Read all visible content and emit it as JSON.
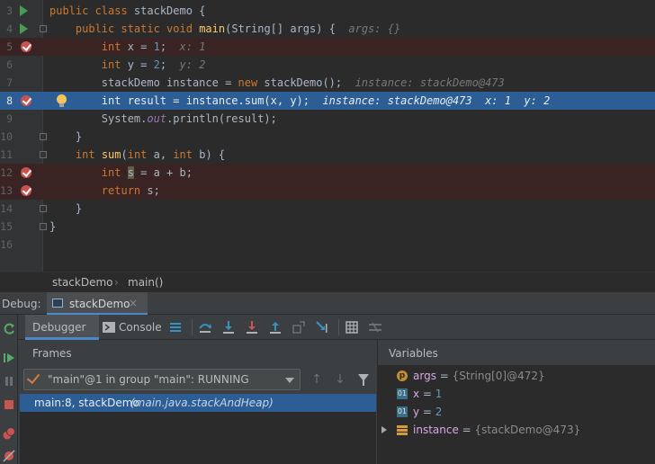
{
  "editor": {
    "lines": [
      {
        "num": "3"
      },
      {
        "num": "4"
      },
      {
        "num": "5"
      },
      {
        "num": "6"
      },
      {
        "num": "7"
      },
      {
        "num": "8"
      },
      {
        "num": "9"
      },
      {
        "num": "10"
      },
      {
        "num": "11"
      },
      {
        "num": "12"
      },
      {
        "num": "13"
      },
      {
        "num": "14"
      },
      {
        "num": "15"
      },
      {
        "num": "16"
      }
    ],
    "tokens": {
      "l3_kw": "public class ",
      "l3_txt": "stackDemo {",
      "l4_kw": "public static void ",
      "l4_fn": "main",
      "l4_txt": "(String[] args) {",
      "l4_hint": "args: {}",
      "l5_kw": "int ",
      "l5_txt1": "x = ",
      "l5_num": "1",
      "l5_txt2": ";",
      "l5_hint": "x: 1",
      "l6_kw": "int ",
      "l6_txt1": "y = ",
      "l6_num": "2",
      "l6_txt2": ";",
      "l6_hint": "y: 2",
      "l7_txt1": "stackDemo instance = ",
      "l7_kw": "new ",
      "l7_txt2": "stackDemo();",
      "l7_hint": "instance: stackDemo@473",
      "l8_kw": "int ",
      "l8_txt": "result = instance.sum(x, y);",
      "l8_hint": "instance: stackDemo@473  x: 1  y: 2",
      "l9_txt1": "System.",
      "l9_fld": "out",
      "l9_txt2": ".println(result);",
      "l10_txt": "}",
      "l11_kw1": "int ",
      "l11_fn": "sum",
      "l11_txt1": "(",
      "l11_kw2": "int ",
      "l11_txt2": "a, ",
      "l11_kw3": "int ",
      "l11_txt3": "b) {",
      "l12_kw": "int ",
      "l12_hl": "s",
      "l12_txt": " = a + b;",
      "l13_kw": "return ",
      "l13_txt": "s;",
      "l14_txt": "}",
      "l15_txt": "}"
    }
  },
  "breadcrumb": {
    "item1": "stackDemo",
    "sep": "›",
    "item2": "main()"
  },
  "debug_bar": {
    "label": "Debug:",
    "session_tab": "stackDemo",
    "close": "×"
  },
  "toolbar": {
    "debugger_tab": "Debugger",
    "console_tab": "Console"
  },
  "frames": {
    "header": "Frames",
    "thread_selector": "\"main\"@1 in group \"main\": RUNNING",
    "rows": [
      {
        "main": "main:8, stackDemo",
        "sub": "(main.java.stackAndHeap)"
      }
    ]
  },
  "variables": {
    "header": "Variables",
    "items": [
      {
        "icon": "p",
        "name": "args",
        "eq": " = ",
        "value": "{String[0]@472}"
      },
      {
        "icon": "01",
        "name": "x",
        "eq": " = ",
        "value": "1"
      },
      {
        "icon": "01",
        "name": "y",
        "eq": " = ",
        "value": "2"
      },
      {
        "icon": "stack",
        "name": "instance",
        "eq": " = ",
        "value": "{stackDemo@473}"
      }
    ]
  },
  "colors": {
    "editor_bg": "#2b2b2b",
    "exec_line": "#2d5d95",
    "breakpoint_line": "#3a2323",
    "keyword": "#cc7832",
    "function": "#ffc66d",
    "number": "#6897bb",
    "accent": "#4a88c7"
  }
}
